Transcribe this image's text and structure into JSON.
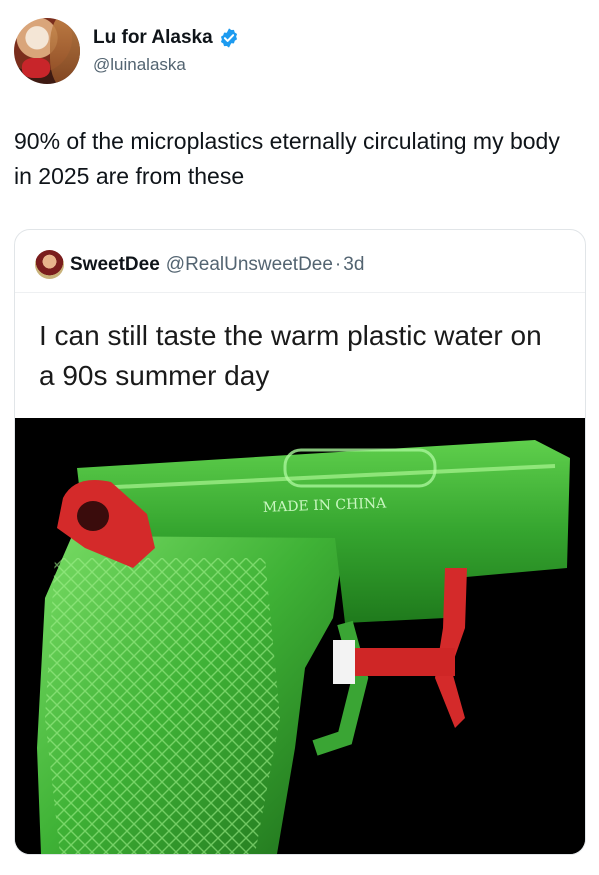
{
  "author": {
    "display_name": "Lu for Alaska",
    "handle": "@luinalaska",
    "avatar_icon": "profile-photo",
    "verified_icon": "verified-badge-icon",
    "verified_color": "#1d9bf0"
  },
  "tweet": {
    "text": "90% of the microplastics eternally circulating my body in 2025 are from these"
  },
  "quoted": {
    "display_name": "SweetDee",
    "handle": "@RealUnsweetDee",
    "separator": "·",
    "time": "3d",
    "text": "I can still taste the warm plastic water on a 90s summer day",
    "image": {
      "subject": "green-water-pistol",
      "engraving": "MADE IN CHINA",
      "colors": {
        "body": "#3ea83a",
        "accent": "#d42a2a",
        "background": "#000000"
      }
    }
  }
}
